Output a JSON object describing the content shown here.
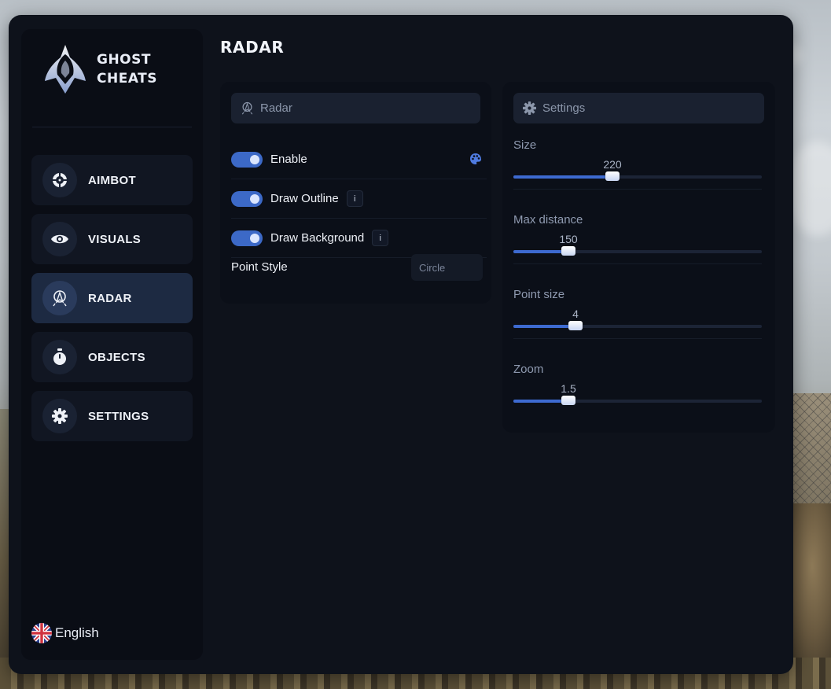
{
  "brand": {
    "line1": "GHOST",
    "line2": "CHEATS"
  },
  "colors": {
    "accent": "#3d6ad0",
    "window_bg": "#0e121b",
    "sidebar_bg": "#0a0d15",
    "active_nav": "#1d2a42"
  },
  "sidebar": {
    "items": [
      {
        "label": "AIMBOT",
        "icon": "crosshair-icon",
        "active": false
      },
      {
        "label": "VISUALS",
        "icon": "eye-icon",
        "active": false
      },
      {
        "label": "RADAR",
        "icon": "radar-icon",
        "active": true
      },
      {
        "label": "OBJECTS",
        "icon": "stopwatch-icon",
        "active": false
      },
      {
        "label": "SETTINGS",
        "icon": "gear-icon",
        "active": false
      }
    ],
    "language": "English"
  },
  "page": {
    "title": "RADAR"
  },
  "radar_panel": {
    "title": "Radar",
    "toggles": [
      {
        "label": "Enable",
        "on": true
      },
      {
        "label": "Draw Outline",
        "on": true,
        "info": "i"
      },
      {
        "label": "Draw Background",
        "on": true,
        "info": "i"
      }
    ],
    "point_style": {
      "label": "Point Style",
      "value": "Circle"
    }
  },
  "settings_panel": {
    "title": "Settings",
    "sliders": [
      {
        "label": "Size",
        "value": "220",
        "fill": 0.4
      },
      {
        "label": "Max distance",
        "value": "150",
        "fill": 0.22
      },
      {
        "label": "Point size",
        "value": "4",
        "fill": 0.25
      },
      {
        "label": "Zoom",
        "value": "1.5",
        "fill": 0.22
      }
    ]
  }
}
